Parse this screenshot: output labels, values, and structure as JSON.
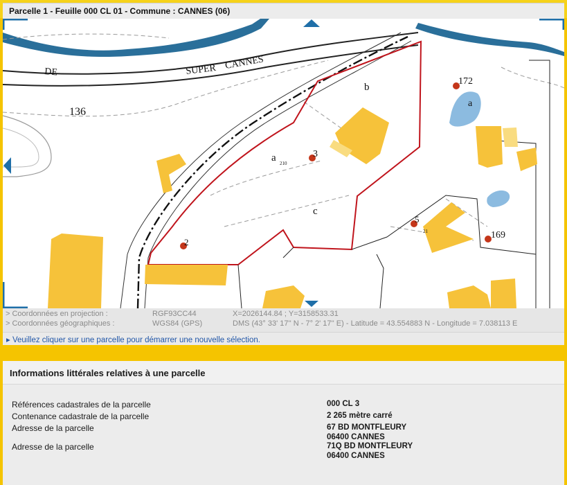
{
  "window": {
    "title": "Parcelle 1 - Feuille 000 CL 01 - Commune : CANNES (06)"
  },
  "map": {
    "street_labels": [
      "DE",
      "SUPER",
      "CANNES"
    ],
    "parcel_numbers": [
      "136",
      "3",
      "2",
      "5",
      "172",
      "169"
    ],
    "lot_letters": [
      "a",
      "b",
      "c",
      "a"
    ],
    "small_labels": [
      "210",
      "21"
    ],
    "colors": {
      "parcel_outline": "#c0141c",
      "building": "#f6c23a",
      "water": "#8cbbe0",
      "river": "#2a6f9a",
      "marker": "#c4361a",
      "nav_arrow": "#1f6fa8"
    }
  },
  "coordinates": {
    "projection_label": "> Coordonnées en projection :",
    "projection_system": "RGF93CC44",
    "projection_value": "X=2026144.84 ; Y=3158533.31",
    "geo_label": "> Coordonnées géographiques :",
    "geo_system": "WGS84 (GPS)",
    "geo_value": "DMS (43° 33' 17'' N - 7° 2' 17'' E) - Latitude = 43.554883 N - Longitude = 7.038113 E"
  },
  "notice": {
    "text": "▸ Veuillez cliquer sur une parcelle pour démarrer une nouvelle sélection."
  },
  "info_panel": {
    "title": "Informations littérales relatives à une parcelle",
    "rows": [
      {
        "label": "Références cadastrales de la parcelle",
        "value": "000 CL 3"
      },
      {
        "label": "Contenance cadastrale de la parcelle",
        "value": "2 265 mètre carré"
      },
      {
        "label": "Adresse de la parcelle",
        "value_line1": "67 BD MONTFLEURY",
        "value_line2": "06400 CANNES"
      },
      {
        "label": "Adresse de la parcelle",
        "value_line1": "71Q BD MONTFLEURY",
        "value_line2": "06400 CANNES"
      }
    ]
  }
}
